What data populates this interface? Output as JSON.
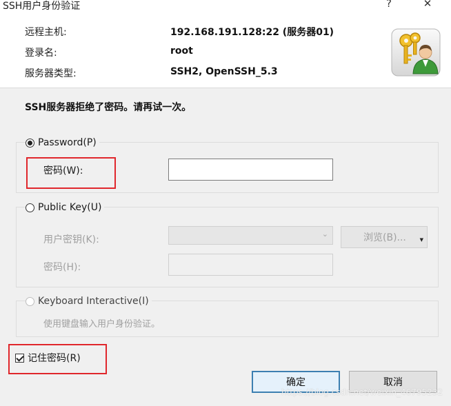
{
  "window": {
    "title": "SSH用户身份验证",
    "help_glyph": "?",
    "close_glyph": "✕"
  },
  "info": {
    "host_label": "远程主机:",
    "host_value": "192.168.191.128:22 (服务器01)",
    "login_label": "登录名:",
    "login_value": "root",
    "server_type_label": "服务器类型:",
    "server_type_value": "SSH2, OpenSSH_5.3"
  },
  "message": "SSH服务器拒绝了密码。请再试一次。",
  "password_method": {
    "label": "Password(P)",
    "selected": true,
    "field_label": "密码(W):",
    "field_value": ""
  },
  "publickey_method": {
    "label": "Public Key(U)",
    "selected": false,
    "key_label": "用户密钥(K):",
    "key_value": "",
    "browse_label": "浏览(B)...",
    "passphrase_label": "密码(H):",
    "passphrase_value": ""
  },
  "keyboard_method": {
    "label": "Keyboard Interactive(I)",
    "selected": false,
    "description": "使用键盘输入用户身份验证。"
  },
  "remember_password": {
    "label": "记住密码(R)",
    "checked": true
  },
  "buttons": {
    "ok_label": "确定",
    "cancel_label": "取消"
  },
  "watermark": "https://blog.csdn.net/weixin_46795232",
  "colors": {
    "highlight_border": "#e0262b",
    "dialog_bg": "#f0f0f0",
    "default_button_border": "#3c7fb1"
  },
  "icons": {
    "dialog_icon": "user-key-icon",
    "combo_arrow": "chevron-down-icon",
    "browse_arrow": "dropdown-arrow-icon"
  }
}
